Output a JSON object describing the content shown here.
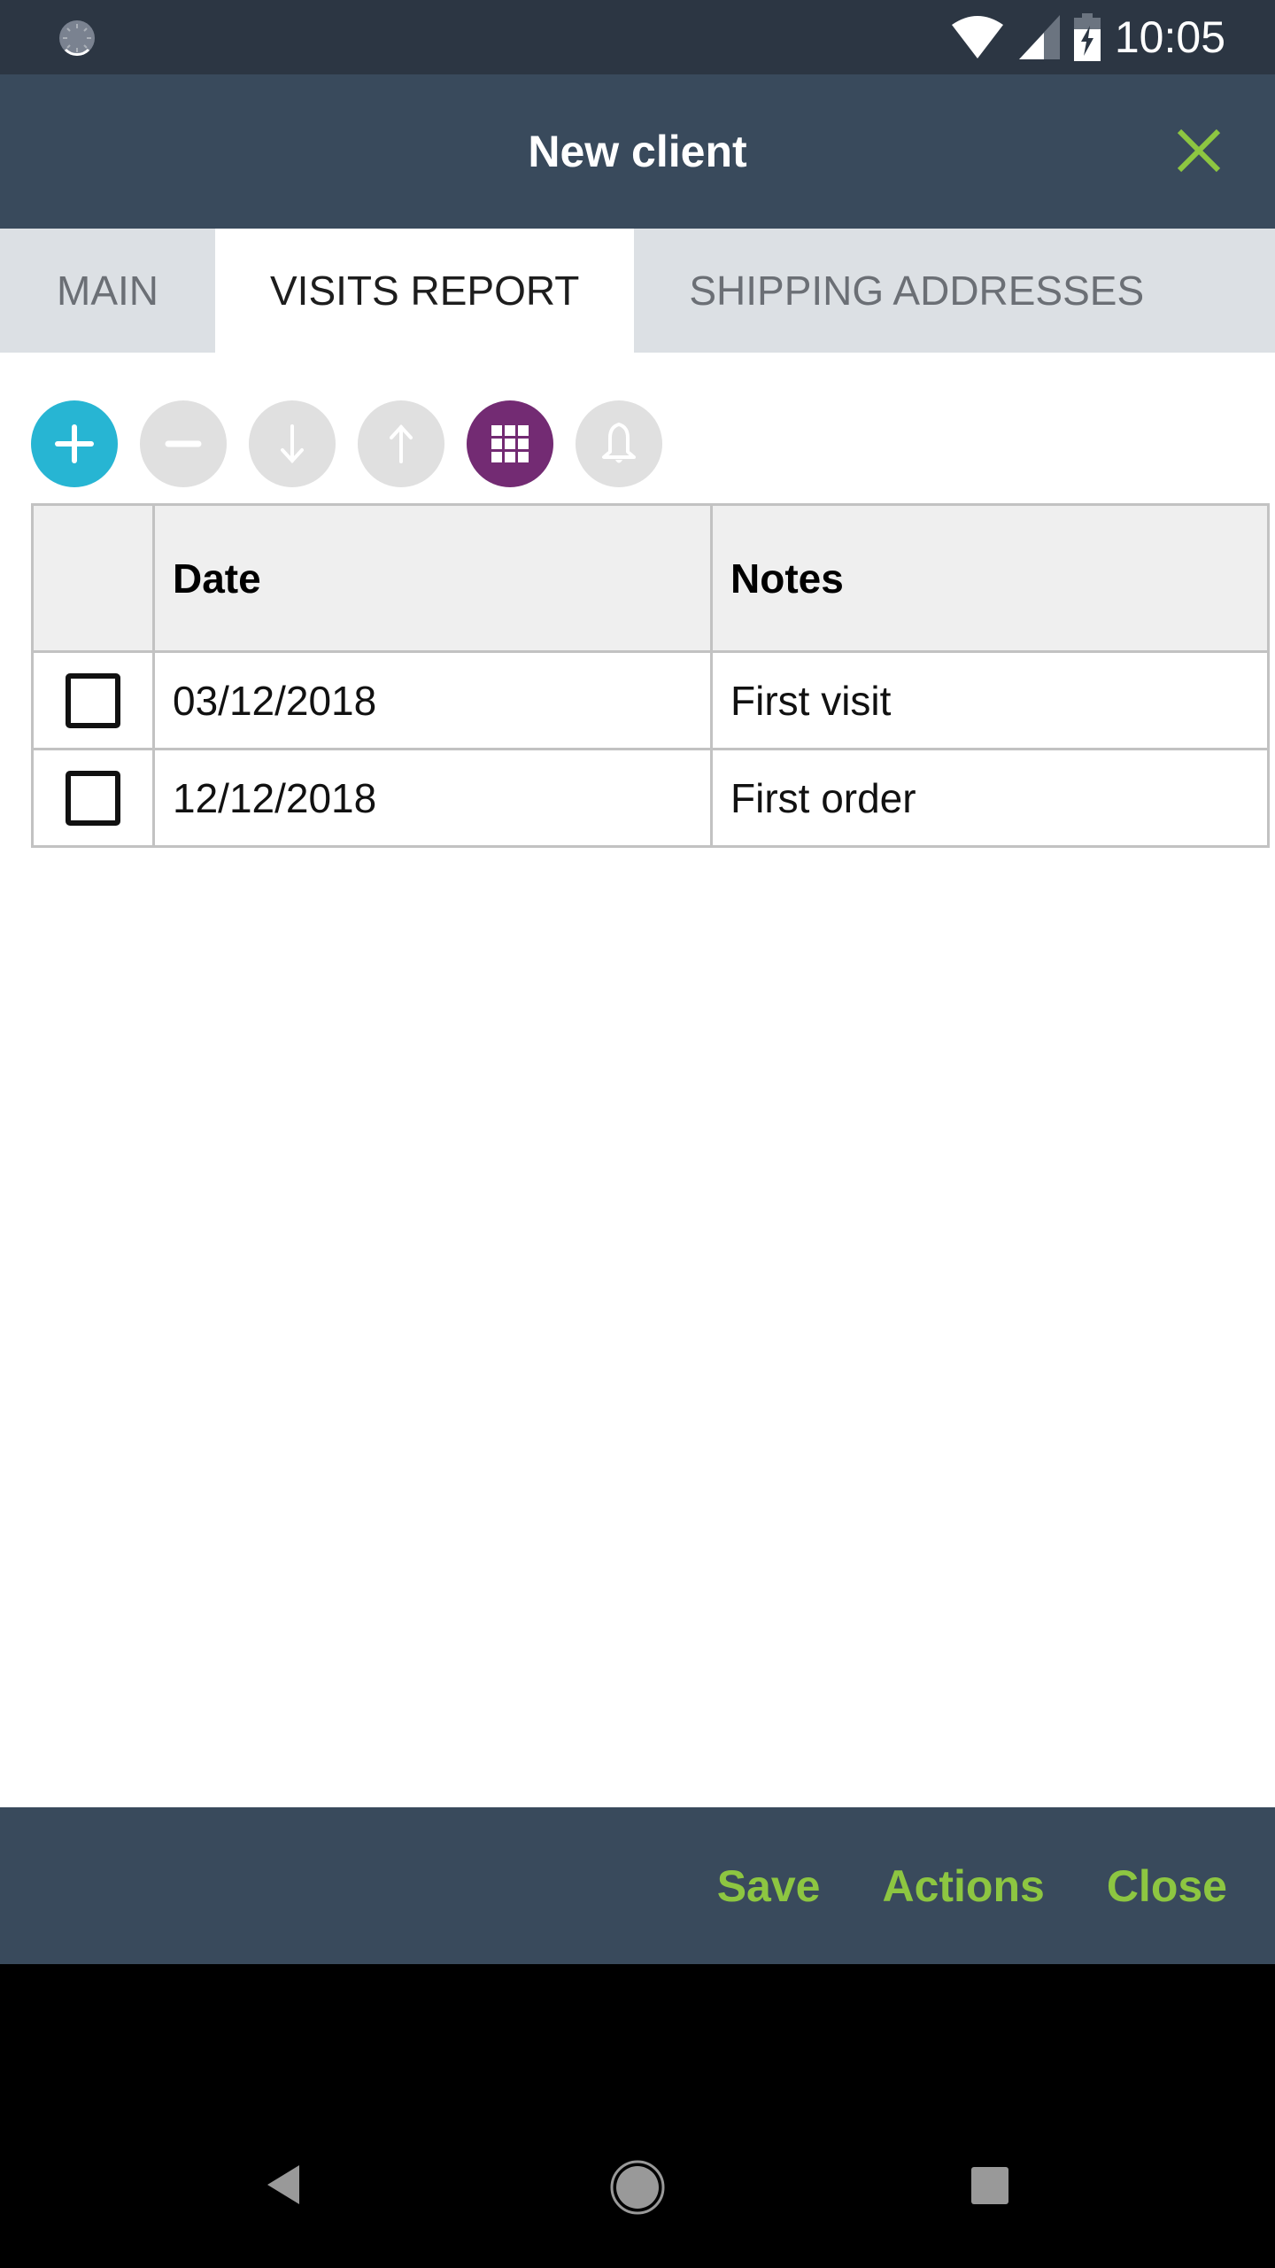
{
  "status_bar": {
    "time": "10:05",
    "icons": [
      "sync-icon",
      "wifi-icon",
      "signal-icon",
      "battery-charging-icon"
    ]
  },
  "app_bar": {
    "title": "New client",
    "close_icon": "close-icon"
  },
  "colors": {
    "status_bar_bg": "#2c3643",
    "app_bar_bg": "#394a5c",
    "accent_green": "#8dc641",
    "add_button": "#27b5d3",
    "grid_button": "#732b73",
    "disabled_button": "#e0e0e0",
    "tab_bar_bg": "#dce0e4"
  },
  "tabs": [
    {
      "label": "MAIN",
      "active": false
    },
    {
      "label": "VISITS REPORT",
      "active": true
    },
    {
      "label": "SHIPPING ADDRESSES",
      "active": false
    }
  ],
  "toolbar": {
    "buttons": [
      {
        "name": "add",
        "icon": "plus-icon",
        "enabled": true
      },
      {
        "name": "remove",
        "icon": "minus-icon",
        "enabled": false
      },
      {
        "name": "move-down",
        "icon": "arrow-down-icon",
        "enabled": false
      },
      {
        "name": "move-up",
        "icon": "arrow-up-icon",
        "enabled": false
      },
      {
        "name": "grid-view",
        "icon": "grid-icon",
        "enabled": true
      },
      {
        "name": "notify",
        "icon": "bell-icon",
        "enabled": false
      }
    ]
  },
  "table": {
    "columns": [
      "",
      "Date",
      "Notes"
    ],
    "rows": [
      {
        "checked": false,
        "date": "03/12/2018",
        "notes": "First visit"
      },
      {
        "checked": false,
        "date": "12/12/2018",
        "notes": "First order"
      }
    ]
  },
  "bottom_bar": {
    "save_label": "Save",
    "actions_label": "Actions",
    "close_label": "Close"
  },
  "nav_bar": {
    "icons": [
      "back-icon",
      "home-icon",
      "recents-icon"
    ]
  }
}
